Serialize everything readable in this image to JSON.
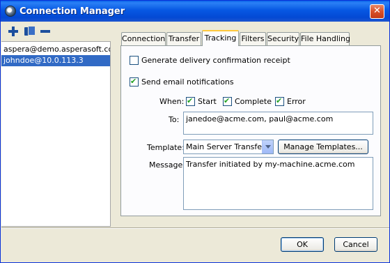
{
  "window": {
    "title": "Connection Manager",
    "close_glyph": "✕"
  },
  "toolbar": {
    "icons": [
      "plus-icon",
      "copy-icon",
      "minus-icon"
    ]
  },
  "connections": [
    {
      "label": "aspera@demo.asperasoft.com",
      "selected": false
    },
    {
      "label": "johndoe@10.0.113.3",
      "selected": true
    }
  ],
  "tabs": [
    {
      "label": "Connection",
      "active": false
    },
    {
      "label": "Transfer",
      "active": false
    },
    {
      "label": "Tracking",
      "active": true
    },
    {
      "label": "Filters",
      "active": false
    },
    {
      "label": "Security",
      "active": false
    },
    {
      "label": "File Handling",
      "active": false
    }
  ],
  "tracking": {
    "delivery_receipt": {
      "label": "Generate delivery confirmation receipt",
      "checked": false
    },
    "email_notifications": {
      "label": "Send email notifications",
      "checked": true
    },
    "when_label": "When:",
    "when_options": [
      {
        "label": "Start",
        "checked": true
      },
      {
        "label": "Complete",
        "checked": true
      },
      {
        "label": "Error",
        "checked": true
      }
    ],
    "to_label": "To:",
    "to_value": "janedoe@acme.com, paul@acme.com",
    "template_label": "Template:",
    "template_value": "Main Server Transfers",
    "manage_templates_label": "Manage Templates...",
    "message_label": "Message:",
    "message_value": "Transfer initiated by my-machine.acme.com"
  },
  "footer": {
    "ok_label": "OK",
    "cancel_label": "Cancel"
  },
  "colors": {
    "titlebar": "#0a5ae3",
    "selection": "#316ac5",
    "active_tab_accent": "#ffc83c",
    "check_mark": "#21a121"
  }
}
